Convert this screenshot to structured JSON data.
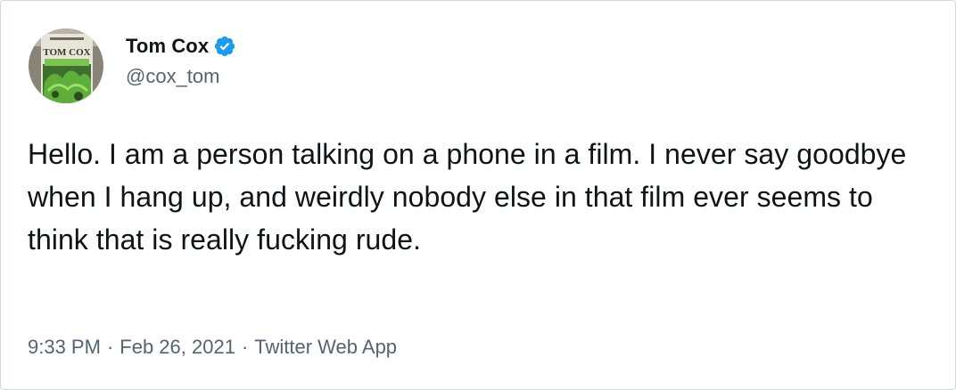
{
  "tweet": {
    "author": {
      "display_name": "Tom Cox",
      "handle": "@cox_tom",
      "verified": true,
      "avatar_icon": "book-cover-avatar",
      "avatar_text": "TOM COX"
    },
    "text": "Hello. I am a person talking on a phone in a film. I never say goodbye when I hang up, and weirdly nobody else in that film ever seems to think that is really fucking rude.",
    "time": "9:33 PM",
    "separator": "·",
    "date": "Feb 26, 2021",
    "source": "Twitter Web App"
  },
  "colors": {
    "text_primary": "#0f1419",
    "text_secondary": "#536471",
    "verified_blue": "#1d9bf0",
    "border": "#cfd9de"
  }
}
